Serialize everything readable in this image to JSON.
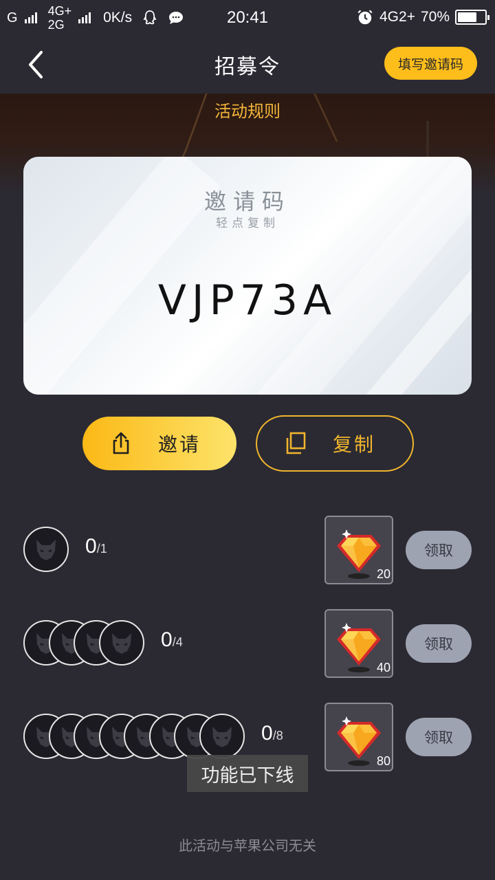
{
  "status_bar": {
    "net1": "G",
    "net2_top": "4G+",
    "net2_bottom": "2G",
    "speed": "0K/s",
    "time": "20:41",
    "net3": "4G2+",
    "battery": "70%",
    "battery_level": 0.7
  },
  "nav": {
    "title": "招募令",
    "invite_code_button": "填写邀请码"
  },
  "hero": {
    "rules_link": "活动规则"
  },
  "code_card": {
    "title": "邀请码",
    "subtitle": "轻点复制",
    "code": "VJP73A"
  },
  "actions": {
    "invite_label": "邀请",
    "copy_label": "复制"
  },
  "rewards": [
    {
      "current": "0",
      "total": "/1",
      "gems": "20",
      "claim": "领取"
    },
    {
      "current": "0",
      "total": "/4",
      "gems": "40",
      "claim": "领取"
    },
    {
      "current": "0",
      "total": "/8",
      "gems": "80",
      "claim": "领取"
    }
  ],
  "toast": "功能已下线",
  "disclaimer": "此活动与苹果公司无关",
  "colors": {
    "background": "#2b2a33",
    "accent": "#fdbd1a",
    "claim_disabled": "#9ea3b2"
  }
}
